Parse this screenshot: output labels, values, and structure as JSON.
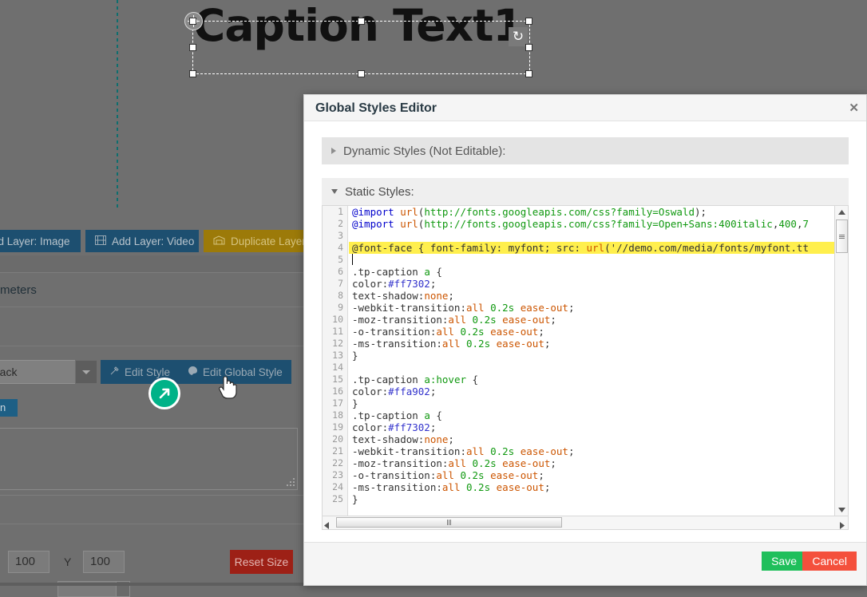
{
  "canvas": {
    "caption_text": "Caption Text1",
    "guide_color": "#0f6e6e"
  },
  "left_panel": {
    "toolbar": [
      {
        "label": "dd Layer: Image",
        "icon": "image-icon",
        "color": "#1d4f70"
      },
      {
        "label": "Add Layer: Video",
        "icon": "video-icon",
        "color": "#1d4f70"
      },
      {
        "label": "Duplicate Layer",
        "icon": "duplicate-icon",
        "color": "#9c7a09"
      }
    ],
    "params_title": "meters",
    "style_select_value": "_black",
    "edit_style_label": "Edit Style",
    "edit_global_style_label": "Edit Global Style",
    "small_blue_button_label": "on",
    "position": {
      "x_value": "100",
      "y_label": "Y",
      "y_value": "100"
    },
    "reset_size_label": "Reset Size"
  },
  "modal": {
    "title": "Global Styles Editor",
    "close_icon": "close-icon",
    "dynamic_section_label": "Dynamic Styles (Not Editable):",
    "static_section_label": "Static Styles:",
    "save_label": "Save",
    "cancel_label": "Cancel",
    "accent_save": "#1fbf5b",
    "accent_cancel": "#f4503c",
    "highlight_color": "#ffef4d",
    "code_lines": [
      {
        "n": 1,
        "highlight": false,
        "tokens": [
          {
            "t": "@import ",
            "c": "k-at"
          },
          {
            "t": "url",
            "c": "k-fn"
          },
          {
            "t": "(",
            "c": "k-plain"
          },
          {
            "t": "http://fonts.googleapis.com/css?family=",
            "c": "k-str"
          },
          {
            "t": "Oswald",
            "c": "k-str"
          },
          {
            "t": ");",
            "c": "k-plain"
          }
        ]
      },
      {
        "n": 2,
        "highlight": false,
        "tokens": [
          {
            "t": "@import ",
            "c": "k-at"
          },
          {
            "t": "url",
            "c": "k-fn"
          },
          {
            "t": "(",
            "c": "k-plain"
          },
          {
            "t": "http://fonts.googleapis.com/css?family=Open+Sans:",
            "c": "k-str"
          },
          {
            "t": "400italic",
            "c": "k-num"
          },
          {
            "t": ",",
            "c": "k-plain"
          },
          {
            "t": "400",
            "c": "k-num"
          },
          {
            "t": ",",
            "c": "k-plain"
          },
          {
            "t": "7",
            "c": "k-num"
          }
        ]
      },
      {
        "n": 3,
        "highlight": false,
        "tokens": []
      },
      {
        "n": 4,
        "highlight": true,
        "tokens": [
          {
            "t": "@font-face",
            "c": "k-plain"
          },
          {
            "t": " { font-family: myfont; src: ",
            "c": "k-plain"
          },
          {
            "t": "url",
            "c": "k-fn"
          },
          {
            "t": "('//demo.com/media/fonts/myfont.tt",
            "c": "k-plain"
          }
        ]
      },
      {
        "n": 5,
        "highlight": false,
        "tokens": []
      },
      {
        "n": 6,
        "highlight": false,
        "tokens": [
          {
            "t": ".tp-caption ",
            "c": "k-sel"
          },
          {
            "t": "a",
            "c": "k-pseudo"
          },
          {
            "t": " {",
            "c": "k-plain"
          }
        ]
      },
      {
        "n": 7,
        "highlight": false,
        "tokens": [
          {
            "t": "color:",
            "c": "k-prop"
          },
          {
            "t": "#ff7302",
            "c": "k-hex"
          },
          {
            "t": ";",
            "c": "k-plain"
          }
        ]
      },
      {
        "n": 8,
        "highlight": false,
        "tokens": [
          {
            "t": "text-shadow:",
            "c": "k-prop"
          },
          {
            "t": "none",
            "c": "k-val"
          },
          {
            "t": ";",
            "c": "k-plain"
          }
        ]
      },
      {
        "n": 9,
        "highlight": false,
        "tokens": [
          {
            "t": "-webkit-transition:",
            "c": "k-prop"
          },
          {
            "t": "all",
            "c": "k-val"
          },
          {
            "t": " ",
            "c": "k-plain"
          },
          {
            "t": "0.2s",
            "c": "k-num"
          },
          {
            "t": " ",
            "c": "k-plain"
          },
          {
            "t": "ease-out",
            "c": "k-val"
          },
          {
            "t": ";",
            "c": "k-plain"
          }
        ]
      },
      {
        "n": 10,
        "highlight": false,
        "tokens": [
          {
            "t": "-moz-transition:",
            "c": "k-prop"
          },
          {
            "t": "all",
            "c": "k-val"
          },
          {
            "t": " ",
            "c": "k-plain"
          },
          {
            "t": "0.2s",
            "c": "k-num"
          },
          {
            "t": " ",
            "c": "k-plain"
          },
          {
            "t": "ease-out",
            "c": "k-val"
          },
          {
            "t": ";",
            "c": "k-plain"
          }
        ]
      },
      {
        "n": 11,
        "highlight": false,
        "tokens": [
          {
            "t": "-o-transition:",
            "c": "k-prop"
          },
          {
            "t": "all",
            "c": "k-val"
          },
          {
            "t": " ",
            "c": "k-plain"
          },
          {
            "t": "0.2s",
            "c": "k-num"
          },
          {
            "t": " ",
            "c": "k-plain"
          },
          {
            "t": "ease-out",
            "c": "k-val"
          },
          {
            "t": ";",
            "c": "k-plain"
          }
        ]
      },
      {
        "n": 12,
        "highlight": false,
        "tokens": [
          {
            "t": "-ms-transition:",
            "c": "k-prop"
          },
          {
            "t": "all",
            "c": "k-val"
          },
          {
            "t": " ",
            "c": "k-plain"
          },
          {
            "t": "0.2s",
            "c": "k-num"
          },
          {
            "t": " ",
            "c": "k-plain"
          },
          {
            "t": "ease-out",
            "c": "k-val"
          },
          {
            "t": ";",
            "c": "k-plain"
          }
        ]
      },
      {
        "n": 13,
        "highlight": false,
        "tokens": [
          {
            "t": "}",
            "c": "k-plain"
          }
        ]
      },
      {
        "n": 14,
        "highlight": false,
        "tokens": []
      },
      {
        "n": 15,
        "highlight": false,
        "tokens": [
          {
            "t": ".tp-caption ",
            "c": "k-sel"
          },
          {
            "t": "a:hover",
            "c": "k-pseudo"
          },
          {
            "t": " {",
            "c": "k-plain"
          }
        ]
      },
      {
        "n": 16,
        "highlight": false,
        "tokens": [
          {
            "t": "color:",
            "c": "k-prop"
          },
          {
            "t": "#ffa902",
            "c": "k-hex"
          },
          {
            "t": ";",
            "c": "k-plain"
          }
        ]
      },
      {
        "n": 17,
        "highlight": false,
        "tokens": [
          {
            "t": "}",
            "c": "k-plain"
          }
        ]
      },
      {
        "n": 18,
        "highlight": false,
        "tokens": [
          {
            "t": ".tp-caption ",
            "c": "k-sel"
          },
          {
            "t": "a",
            "c": "k-pseudo"
          },
          {
            "t": " {",
            "c": "k-plain"
          }
        ]
      },
      {
        "n": 19,
        "highlight": false,
        "tokens": [
          {
            "t": "color:",
            "c": "k-prop"
          },
          {
            "t": "#ff7302",
            "c": "k-hex"
          },
          {
            "t": ";",
            "c": "k-plain"
          }
        ]
      },
      {
        "n": 20,
        "highlight": false,
        "tokens": [
          {
            "t": "text-shadow:",
            "c": "k-prop"
          },
          {
            "t": "none",
            "c": "k-val"
          },
          {
            "t": ";",
            "c": "k-plain"
          }
        ]
      },
      {
        "n": 21,
        "highlight": false,
        "tokens": [
          {
            "t": "-webkit-transition:",
            "c": "k-prop"
          },
          {
            "t": "all",
            "c": "k-val"
          },
          {
            "t": " ",
            "c": "k-plain"
          },
          {
            "t": "0.2s",
            "c": "k-num"
          },
          {
            "t": " ",
            "c": "k-plain"
          },
          {
            "t": "ease-out",
            "c": "k-val"
          },
          {
            "t": ";",
            "c": "k-plain"
          }
        ]
      },
      {
        "n": 22,
        "highlight": false,
        "tokens": [
          {
            "t": "-moz-transition:",
            "c": "k-prop"
          },
          {
            "t": "all",
            "c": "k-val"
          },
          {
            "t": " ",
            "c": "k-plain"
          },
          {
            "t": "0.2s",
            "c": "k-num"
          },
          {
            "t": " ",
            "c": "k-plain"
          },
          {
            "t": "ease-out",
            "c": "k-val"
          },
          {
            "t": ";",
            "c": "k-plain"
          }
        ]
      },
      {
        "n": 23,
        "highlight": false,
        "tokens": [
          {
            "t": "-o-transition:",
            "c": "k-prop"
          },
          {
            "t": "all",
            "c": "k-val"
          },
          {
            "t": " ",
            "c": "k-plain"
          },
          {
            "t": "0.2s",
            "c": "k-num"
          },
          {
            "t": " ",
            "c": "k-plain"
          },
          {
            "t": "ease-out",
            "c": "k-val"
          },
          {
            "t": ";",
            "c": "k-plain"
          }
        ]
      },
      {
        "n": 24,
        "highlight": false,
        "tokens": [
          {
            "t": "-ms-transition:",
            "c": "k-prop"
          },
          {
            "t": "all",
            "c": "k-val"
          },
          {
            "t": " ",
            "c": "k-plain"
          },
          {
            "t": "0.2s",
            "c": "k-num"
          },
          {
            "t": " ",
            "c": "k-plain"
          },
          {
            "t": "ease-out",
            "c": "k-val"
          },
          {
            "t": ";",
            "c": "k-plain"
          }
        ]
      },
      {
        "n": 25,
        "highlight": false,
        "tokens": [
          {
            "t": "}",
            "c": "k-plain"
          }
        ]
      }
    ]
  }
}
